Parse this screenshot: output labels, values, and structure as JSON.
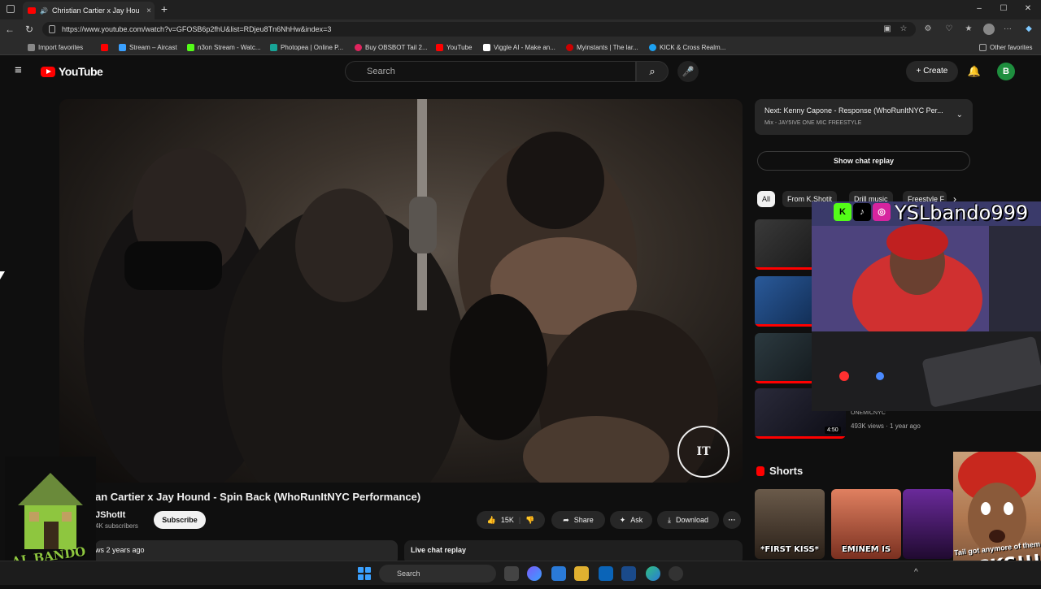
{
  "browser": {
    "tab_title": "Christian Cartier x Jay Houn",
    "tab_close": "×",
    "new_tab": "+",
    "url": "https://www.youtube.com/watch?v=GFOSB6p2fhU&list=RDjeu8Tn6NhHw&index=3",
    "window_controls": {
      "minimize": "–",
      "maximize": "☐",
      "close": "✕"
    },
    "nav": {
      "back": "←",
      "refresh": "↻"
    },
    "favorites": [
      {
        "label": "Import favorites",
        "color": "#888888"
      },
      {
        "label": "Stream – Aircast",
        "color": "#3aa0ff"
      },
      {
        "label": "n3on Stream - Watc...",
        "color": "#53fc18"
      },
      {
        "label": "Photopea | Online P...",
        "color": "#18a497"
      },
      {
        "label": "Buy OBSBOT Tail 2...",
        "color": "#e0245e"
      },
      {
        "label": "YouTube",
        "color": "#ff0000"
      },
      {
        "label": "Viggle AI - Make an...",
        "color": "#ffffff"
      },
      {
        "label": "Myinstants | The lar...",
        "color": "#cc0000"
      },
      {
        "label": "KICK & Cross Realm...",
        "color": "#1da1f2"
      }
    ],
    "other_favorites": "Other favorites"
  },
  "youtube": {
    "logo_text": "YouTube",
    "search_placeholder": "Search",
    "create_label": "Create",
    "user_initial": "B",
    "video": {
      "title": "an Cartier x Jay Hound - Spin Back (WhoRunItNYC Performance)",
      "channel": "JShotIt",
      "subscribers": "4K subscribers",
      "subscribe_label": "Subscribe",
      "likes": "15K",
      "share_label": "Share",
      "ask_label": "Ask",
      "download_label": "Download",
      "more_label": "···",
      "views_time": "ws  2 years ago",
      "live_chat_replay": "Live chat replay",
      "watermark": "IT"
    },
    "sidebar": {
      "next_title": "Next: Kenny Capone - Response (WhoRunItNYC Per...",
      "next_sub": "Mix - JAY5IVE ONE MIC FREESTYLE",
      "show_chat_replay": "Show chat replay",
      "chips": [
        "All",
        "From K.Shotit",
        "Drill music",
        "Freestyle F"
      ],
      "video4_duration": "4:50",
      "video4_channel": "ONEMICNYC",
      "video4_meta": "493K views · 1 year ago",
      "shorts_label": "Shorts",
      "shorts": [
        {
          "caption": "*FIRST KISS*",
          "color": "#5a4a3a"
        },
        {
          "caption": "EMINEM IS",
          "color": "#c25a40"
        },
        {
          "caption": "",
          "color": "#4a2a6a"
        }
      ]
    }
  },
  "overlays": {
    "webcam_handle": "YSLbando999",
    "alert_text": "Tail got anymore of them",
    "alert_big": "KICKS!!!",
    "logo_text": "AL BANDO"
  },
  "taskbar": {
    "search_placeholder": "Search"
  }
}
